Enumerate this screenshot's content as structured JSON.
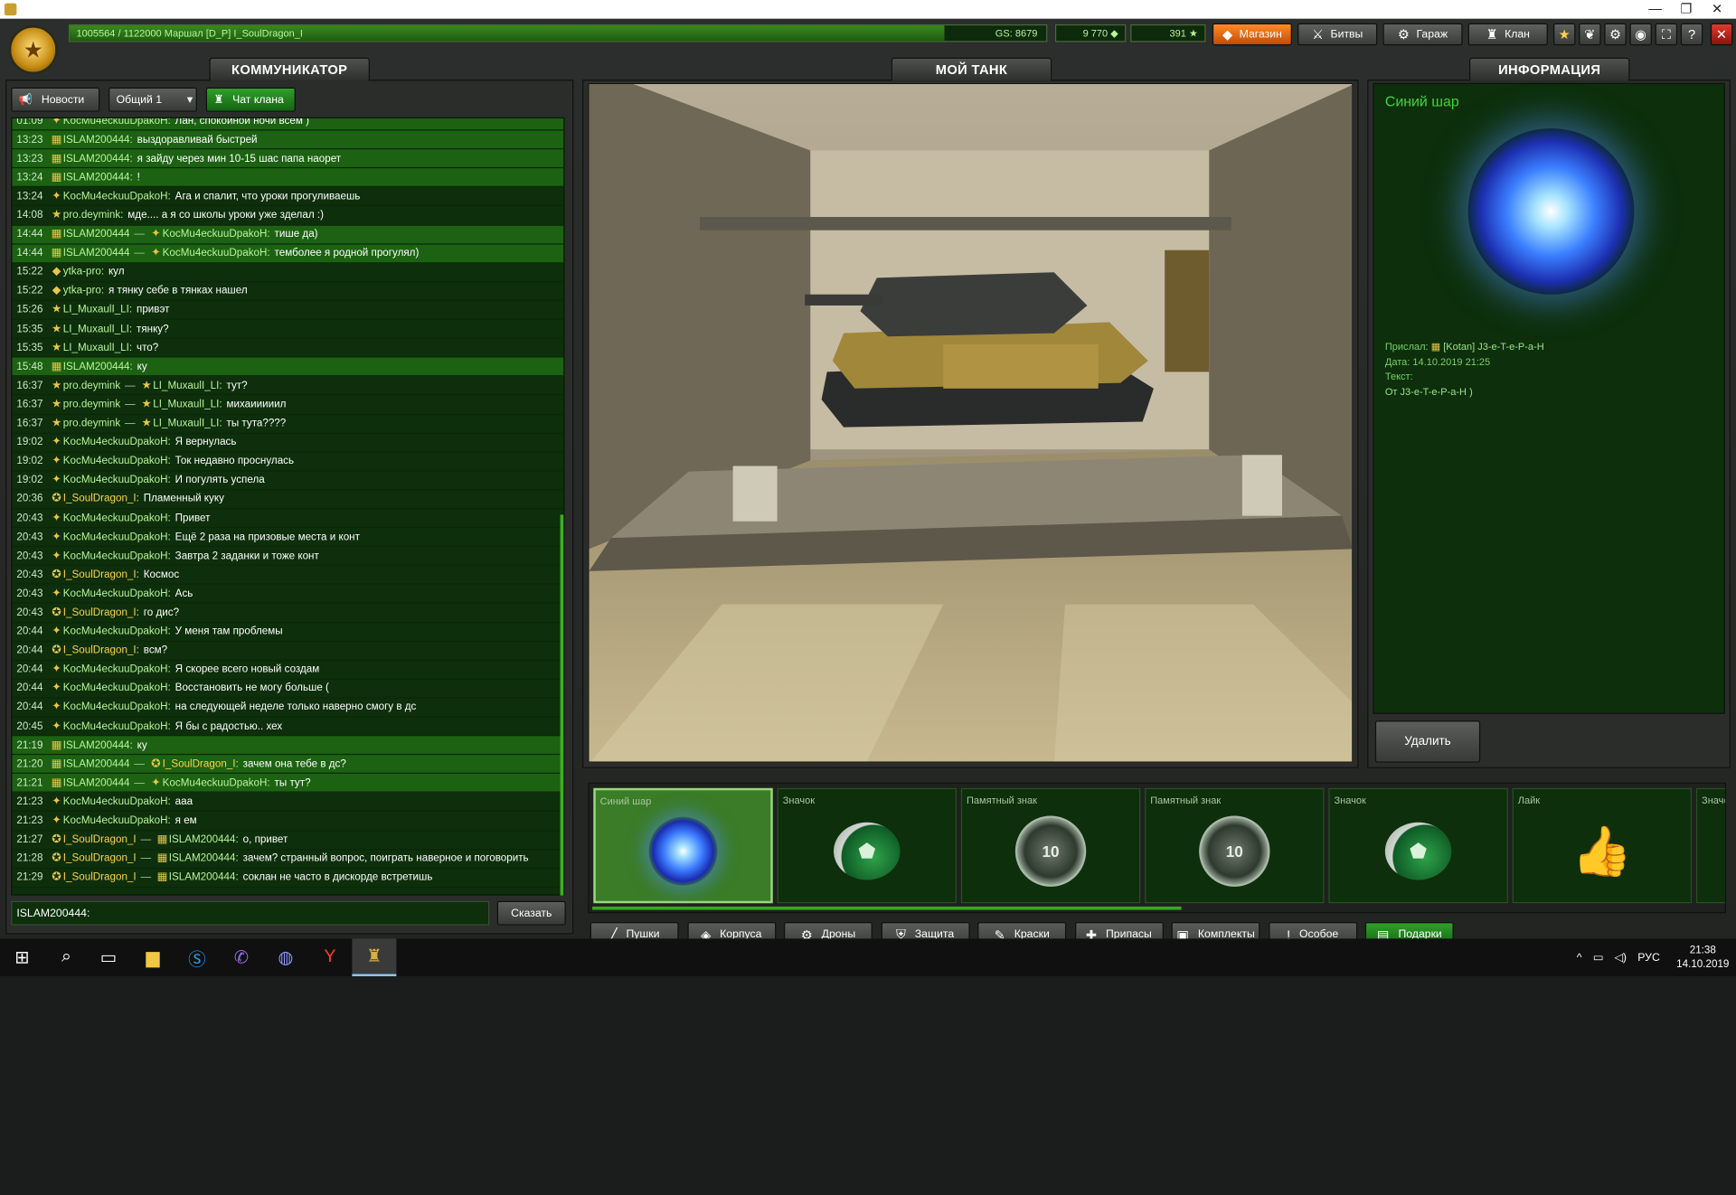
{
  "window": {
    "minimize": "—",
    "restore": "❐",
    "close": "✕"
  },
  "topbar": {
    "exp_text": "1005564 / 1122000  Маршал [D_P] I_SoulDragon_I",
    "exp_fraction": 0.896,
    "gs": "GS: 8679",
    "crystals": "9 770",
    "stars": "391",
    "buttons": {
      "shop": "Магазин",
      "battles": "Битвы",
      "garage": "Гараж",
      "clan": "Клан"
    },
    "icons": [
      "star-icon",
      "wreath-icon",
      "settings-icon",
      "sound-icon",
      "fullscreen-icon",
      "help-icon",
      "close-icon"
    ]
  },
  "tabs": {
    "communicator": "КОММУНИКАТОР",
    "my_tank": "МОЙ ТАНК",
    "info": "ИНФОРМАЦИЯ"
  },
  "communicator": {
    "news": "Новости",
    "channel": "Общий 1",
    "clan_chat": "Чат клана",
    "input_value": "ISLAM200444:",
    "say": "Сказать",
    "messages": [
      {
        "t": "01:09",
        "u": "KocMu4eckuuDpakoH",
        "m": "Лан, спокойной ночи всем )",
        "hl": true,
        "cut": true
      },
      {
        "t": "13:23",
        "u": "ISLAM200444",
        "m": "выздоравливай быстрей",
        "hl": true
      },
      {
        "t": "13:23",
        "u": "ISLAM200444",
        "m": "я зайду через мин 10-15 шас папа наорет",
        "hl": true
      },
      {
        "t": "13:24",
        "u": "ISLAM200444",
        "m": "!",
        "hl": true
      },
      {
        "t": "13:24",
        "u": "KocMu4eckuuDpakoH",
        "m": "Ага и спалит, что уроки прогуливаешь"
      },
      {
        "t": "14:08",
        "u": "pro.deymink",
        "m": "мде.... а я со школы уроки уже зделал :)"
      },
      {
        "t": "14:44",
        "u": "ISLAM200444",
        "to": "KocMu4eckuuDpakoH",
        "m": "тише да)",
        "hl": true
      },
      {
        "t": "14:44",
        "u": "ISLAM200444",
        "to": "KocMu4eckuuDpakoH",
        "m": "темболее я родной прогулял)",
        "hl": true
      },
      {
        "t": "15:22",
        "u": "ytka-pro",
        "m": "кул"
      },
      {
        "t": "15:22",
        "u": "ytka-pro",
        "m": "я тянку себе в тянках нашел"
      },
      {
        "t": "15:26",
        "u": "LI_MuxaulI_LI",
        "m": "привэт"
      },
      {
        "t": "15:35",
        "u": "LI_MuxaulI_LI",
        "m": "тянку?"
      },
      {
        "t": "15:35",
        "u": "LI_MuxaulI_LI",
        "m": "что?"
      },
      {
        "t": "15:48",
        "u": "ISLAM200444",
        "m": "ку",
        "hl": true
      },
      {
        "t": "16:37",
        "u": "pro.deymink",
        "to": "LI_MuxaulI_LI",
        "m": "тут?"
      },
      {
        "t": "16:37",
        "u": "pro.deymink",
        "to": "LI_MuxaulI_LI",
        "m": "михаииииил"
      },
      {
        "t": "16:37",
        "u": "pro.deymink",
        "to": "LI_MuxaulI_LI",
        "m": "ты тута????"
      },
      {
        "t": "19:02",
        "u": "KocMu4eckuuDpakoH",
        "m": "Я вернулась"
      },
      {
        "t": "19:02",
        "u": "KocMu4eckuuDpakoH",
        "m": "Ток недавно проснулась"
      },
      {
        "t": "19:02",
        "u": "KocMu4eckuuDpakoH",
        "m": "И погулять успела"
      },
      {
        "t": "20:36",
        "u": "I_SoulDragon_I",
        "m": "Пламенный куку",
        "gold": true
      },
      {
        "t": "20:43",
        "u": "KocMu4eckuuDpakoH",
        "m": "Привет"
      },
      {
        "t": "20:43",
        "u": "KocMu4eckuuDpakoH",
        "m": "Ещё 2 раза на призовые места и конт"
      },
      {
        "t": "20:43",
        "u": "KocMu4eckuuDpakoH",
        "m": "Завтра 2 заданки и тоже конт"
      },
      {
        "t": "20:43",
        "u": "I_SoulDragon_I",
        "m": "Космос",
        "gold": true
      },
      {
        "t": "20:43",
        "u": "KocMu4eckuuDpakoH",
        "m": "Ась"
      },
      {
        "t": "20:43",
        "u": "I_SoulDragon_I",
        "m": "го дис?",
        "gold": true
      },
      {
        "t": "20:44",
        "u": "KocMu4eckuuDpakoH",
        "m": "У меня там проблемы"
      },
      {
        "t": "20:44",
        "u": "I_SoulDragon_I",
        "m": "всм?",
        "gold": true
      },
      {
        "t": "20:44",
        "u": "KocMu4eckuuDpakoH",
        "m": "Я скорее всего новый создам"
      },
      {
        "t": "20:44",
        "u": "KocMu4eckuuDpakoH",
        "m": "Восстановить не могу больше ("
      },
      {
        "t": "20:44",
        "u": "KocMu4eckuuDpakoH",
        "m": "на следующей неделе только наверно смогу в дс"
      },
      {
        "t": "20:45",
        "u": "KocMu4eckuuDpakoH",
        "m": "Я бы с радостью.. хех"
      },
      {
        "t": "21:19",
        "u": "ISLAM200444",
        "m": "ку",
        "hl": true
      },
      {
        "t": "21:20",
        "u": "ISLAM200444",
        "to": "I_SoulDragon_I",
        "m": "зачем она тебе в дс?",
        "hl": true,
        "togold": true
      },
      {
        "t": "21:21",
        "u": "ISLAM200444",
        "to": "KocMu4eckuuDpakoH",
        "m": "ты тут?",
        "hl": true
      },
      {
        "t": "21:23",
        "u": "KocMu4eckuuDpakoH",
        "m": "ааа"
      },
      {
        "t": "21:23",
        "u": "KocMu4eckuuDpakoH",
        "m": "я ем"
      },
      {
        "t": "21:27",
        "u": "I_SoulDragon_I",
        "to": "ISLAM200444",
        "m": "о, привет",
        "gold": true
      },
      {
        "t": "21:28",
        "u": "I_SoulDragon_I",
        "to": "ISLAM200444",
        "m": "зачем? странный вопрос, поиграть наверное и поговорить",
        "gold": true
      },
      {
        "t": "21:29",
        "u": "I_SoulDragon_I",
        "to": "ISLAM200444",
        "m": "соклан не часто в дискорде встретишь",
        "gold": true
      }
    ]
  },
  "info": {
    "title": "Синий шар",
    "sender_label": "Прислал:",
    "sender": "[Kotan] J3-e-T-e-P-a-H",
    "date": "Дата: 14.10.2019 21:25",
    "text_label": "Текст:",
    "text": "От J3-e-T-e-P-a-H )",
    "delete": "Удалить"
  },
  "items": [
    {
      "label": "Синий шар",
      "kind": "orb"
    },
    {
      "label": "Значок",
      "kind": "badge"
    },
    {
      "label": "Памятный знак",
      "kind": "medal",
      "medal_text": "10"
    },
    {
      "label": "Памятный знак",
      "kind": "medal",
      "medal_text": "10"
    },
    {
      "label": "Значок",
      "kind": "badge"
    },
    {
      "label": "Лайк",
      "kind": "thumb"
    },
    {
      "label": "Значо",
      "kind": "badge"
    }
  ],
  "categories": [
    "Пушки",
    "Корпуса",
    "Дроны",
    "Защита",
    "Краски",
    "Припасы",
    "Комплекты",
    "Особое",
    "Подарки"
  ],
  "taskbar": {
    "lang": "РУС",
    "time": "21:38",
    "date": "14.10.2019"
  }
}
